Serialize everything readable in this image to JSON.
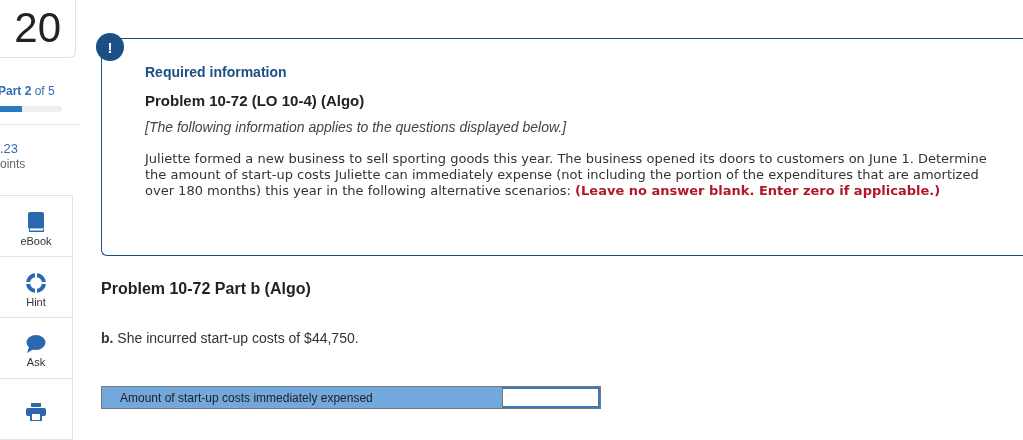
{
  "question_number": "20",
  "part": {
    "label": "**Part 2** of 5",
    "level": 0.35
  },
  "score": {
    "value": ".23",
    "label": "oints"
  },
  "tools": [
    {
      "kind": "ebook",
      "label": "eBook"
    },
    {
      "kind": "hint",
      "label": "Hint"
    },
    {
      "kind": "ask",
      "label": "Ask"
    },
    {
      "kind": "print"
    }
  ],
  "info": {
    "badge": "!",
    "title": "Required information",
    "problem": "Problem 10-72 (LO 10-4) (Algo)",
    "note": "[The following information applies to the questions displayed below.]",
    "body": "Juliette formed a new business to sell sporting goods this year. The business opened its doors to customers on June 1. Determine the amount of start-up costs Juliette can immediately expense (not including the portion of the expenditures that are amortized over 180 months) this year in the following alternative scenarios: **(Leave no answer blank. Enter zero if applicable.)**"
  },
  "part_title": "Problem 10-72 Part b (Algo)",
  "question": "**b.** She incurred start-up costs of $44,750.",
  "answer_table": {
    "label": "Amount of start-up costs immediately expensed"
  }
}
